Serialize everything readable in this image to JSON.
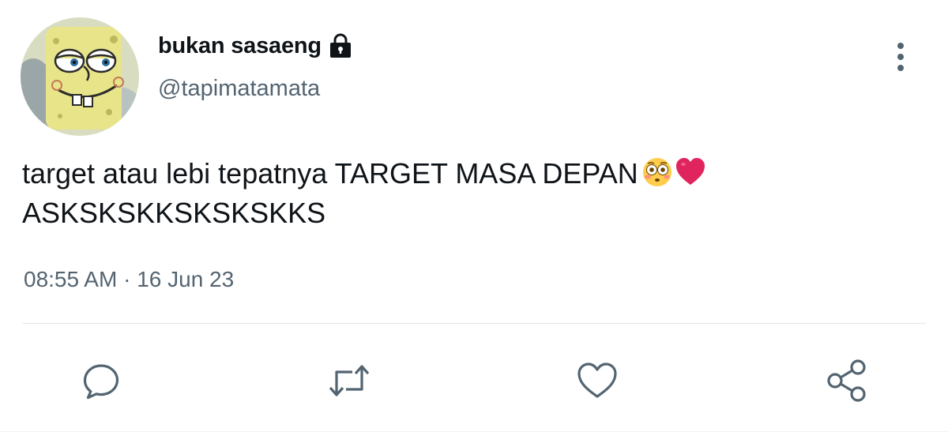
{
  "user": {
    "display_name": "bukan sasaeng",
    "handle": "@tapimatamata",
    "avatar_icon": "spongebob-avatar",
    "protected_icon": "lock-icon"
  },
  "tweet": {
    "text": "target atau lebi tepatnya TARGET MASA DEPAN",
    "text_line2": "ASKSKSKKSKSKSKKS",
    "emojis": [
      "flushed-face-emoji",
      "red-heart-emoji"
    ],
    "time": "08:55 AM",
    "separator": "·",
    "date": "16 Jun 23"
  },
  "actions": [
    {
      "name": "reply",
      "icon": "reply-icon"
    },
    {
      "name": "retweet",
      "icon": "retweet-icon"
    },
    {
      "name": "like",
      "icon": "heart-icon"
    },
    {
      "name": "share",
      "icon": "share-icon"
    }
  ],
  "colors": {
    "text_primary": "#0f1419",
    "text_secondary": "#536471",
    "divider": "#e1e8ed",
    "heart_red": "#e0245e",
    "flushed_yellow": "#ffcc4d"
  }
}
